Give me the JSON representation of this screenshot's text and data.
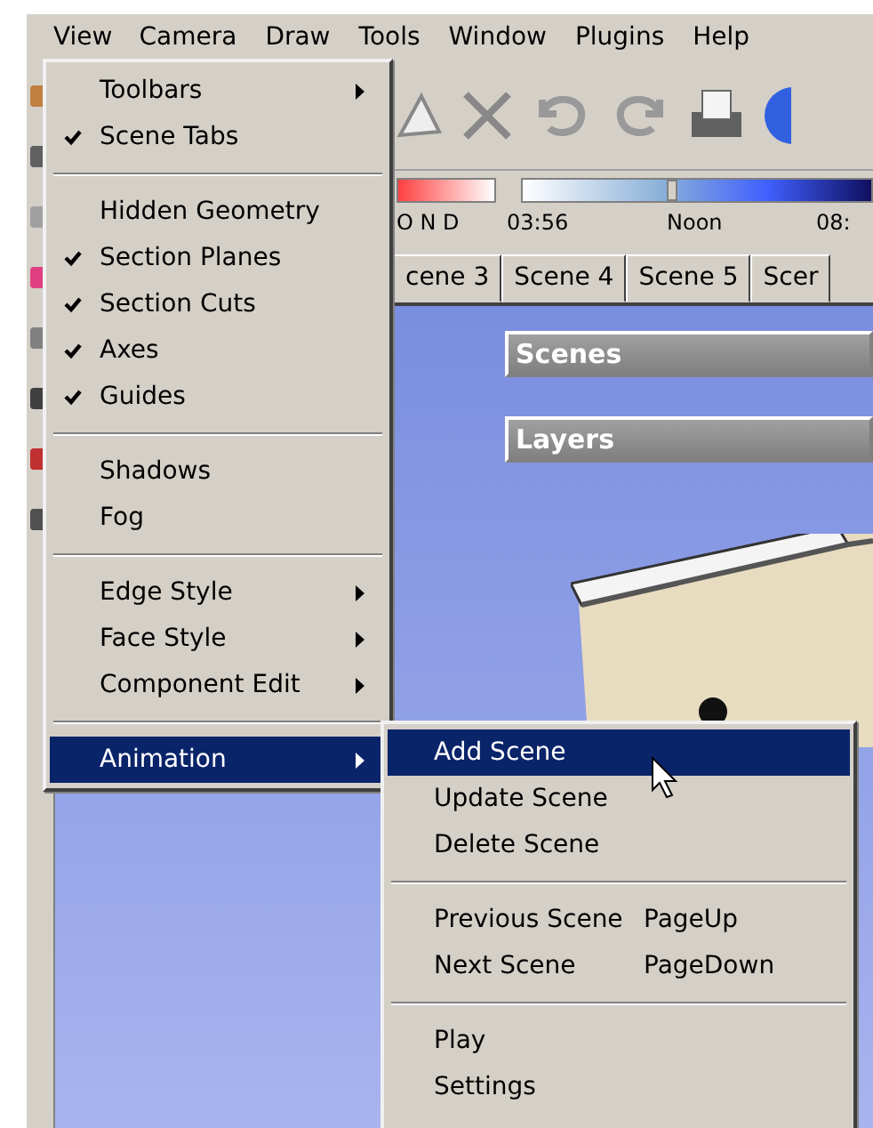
{
  "menubar": [
    {
      "label": "View",
      "selected": true
    },
    {
      "label": "Camera",
      "selected": false
    },
    {
      "label": "Draw",
      "selected": false
    },
    {
      "label": "Tools",
      "selected": false
    },
    {
      "label": "Window",
      "selected": false
    },
    {
      "label": "Plugins",
      "selected": false
    },
    {
      "label": "Help",
      "selected": false
    }
  ],
  "view_menu": [
    {
      "kind": "item",
      "label": "Toolbars",
      "checked": false,
      "has_submenu": true,
      "selected": false
    },
    {
      "kind": "item",
      "label": "Scene Tabs",
      "checked": true,
      "has_submenu": false,
      "selected": false
    },
    {
      "kind": "separator"
    },
    {
      "kind": "item",
      "label": "Hidden Geometry",
      "checked": false,
      "has_submenu": false,
      "selected": false
    },
    {
      "kind": "item",
      "label": "Section Planes",
      "checked": true,
      "has_submenu": false,
      "selected": false
    },
    {
      "kind": "item",
      "label": "Section Cuts",
      "checked": true,
      "has_submenu": false,
      "selected": false
    },
    {
      "kind": "item",
      "label": "Axes",
      "checked": true,
      "has_submenu": false,
      "selected": false
    },
    {
      "kind": "item",
      "label": "Guides",
      "checked": true,
      "has_submenu": false,
      "selected": false
    },
    {
      "kind": "separator"
    },
    {
      "kind": "item",
      "label": "Shadows",
      "checked": false,
      "has_submenu": false,
      "selected": false
    },
    {
      "kind": "item",
      "label": "Fog",
      "checked": false,
      "has_submenu": false,
      "selected": false
    },
    {
      "kind": "separator"
    },
    {
      "kind": "item",
      "label": "Edge Style",
      "checked": false,
      "has_submenu": true,
      "selected": false
    },
    {
      "kind": "item",
      "label": "Face Style",
      "checked": false,
      "has_submenu": true,
      "selected": false
    },
    {
      "kind": "item",
      "label": "Component Edit",
      "checked": false,
      "has_submenu": true,
      "selected": false
    },
    {
      "kind": "separator"
    },
    {
      "kind": "item",
      "label": "Animation",
      "checked": false,
      "has_submenu": true,
      "selected": true
    }
  ],
  "animation_submenu": [
    {
      "kind": "item",
      "label": "Add Scene",
      "selected": true
    },
    {
      "kind": "item",
      "label": "Update Scene",
      "selected": false
    },
    {
      "kind": "item",
      "label": "Delete Scene",
      "selected": false
    },
    {
      "kind": "separator"
    },
    {
      "kind": "item",
      "label": "Previous Scene",
      "shortcut": "PageUp",
      "selected": false
    },
    {
      "kind": "item",
      "label": "Next Scene",
      "shortcut": "PageDown",
      "selected": false
    },
    {
      "kind": "separator"
    },
    {
      "kind": "item",
      "label": "Play",
      "selected": false
    },
    {
      "kind": "item",
      "label": "Settings",
      "selected": false
    }
  ],
  "shadow_settings": {
    "months": "O N D",
    "time_slider": {
      "level": 0.43
    },
    "times": [
      "03:56",
      "Noon",
      "08:"
    ]
  },
  "scene_tabs": [
    "cene 3",
    "Scene 4",
    "Scene 5",
    "Scer"
  ],
  "tray_panels": [
    "Scenes",
    "Layers"
  ]
}
